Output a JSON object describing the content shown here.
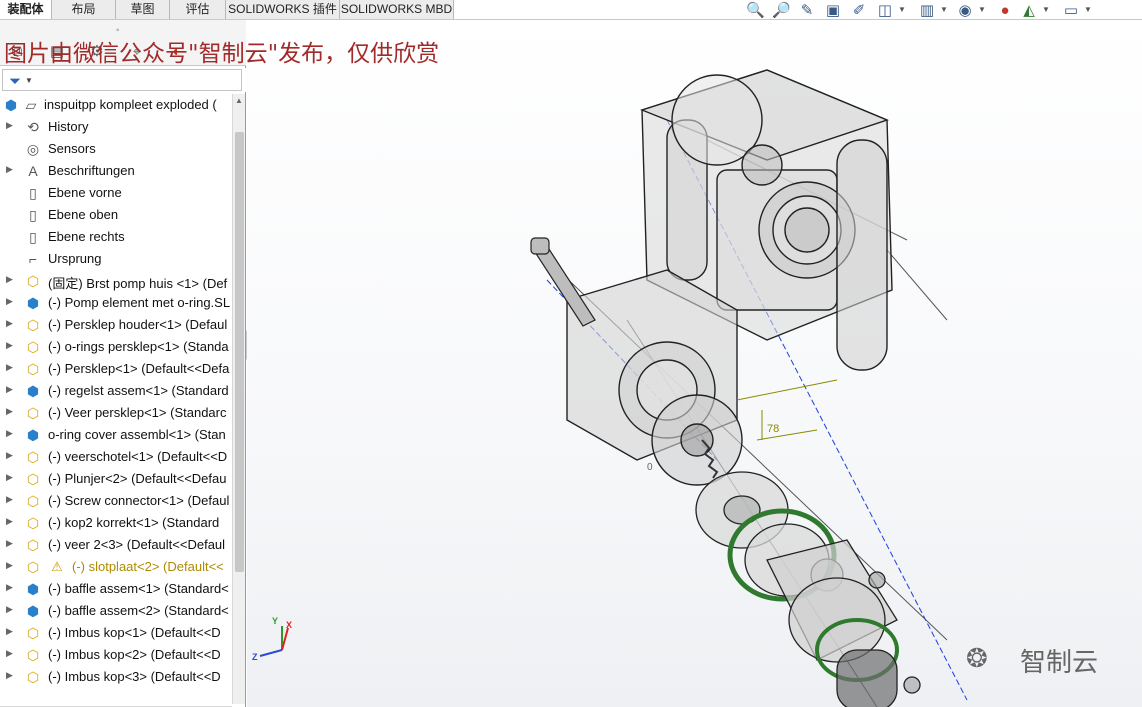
{
  "tabs": [
    {
      "label": "装配体",
      "active": true
    },
    {
      "label": "布局",
      "active": false
    },
    {
      "label": "草图",
      "active": false
    },
    {
      "label": "评估",
      "active": false
    },
    {
      "label": "SOLIDWORKS 插件",
      "active": false
    },
    {
      "label": "SOLIDWORKS MBD",
      "active": false
    }
  ],
  "view_toolbar": {
    "icons": [
      "zoom-to-fit-icon",
      "zoom-to-area-icon",
      "previous-view-icon",
      "section-view-icon",
      "dynamic-annotation-icon",
      "view-orientation-icon",
      "display-style-icon",
      "hide-show-items-icon",
      "edit-appearance-icon",
      "apply-scene-icon",
      "view-settings-icon"
    ]
  },
  "feature_manager": {
    "tabs": [
      "featuremanager-tree-icon",
      "property-manager-icon",
      "configuration-manager-icon",
      "dimxpert-manager-icon",
      "display-manager-icon"
    ],
    "filter_icon": "filter-icon",
    "root": {
      "label": "inspuitpp kompleet exploded  ("
    },
    "items": [
      {
        "label": "History",
        "icon": "history",
        "expandable": true
      },
      {
        "label": "Sensors",
        "icon": "sensor",
        "expandable": false
      },
      {
        "label": "Beschriftungen",
        "icon": "annotation",
        "expandable": true
      },
      {
        "label": "Ebene vorne",
        "icon": "plane",
        "expandable": false
      },
      {
        "label": "Ebene oben",
        "icon": "plane",
        "expandable": false
      },
      {
        "label": "Ebene rechts",
        "icon": "plane",
        "expandable": false
      },
      {
        "label": "Ursprung",
        "icon": "origin",
        "expandable": false
      },
      {
        "label": "(固定) Brst pomp huis <1> (Def",
        "icon": "part",
        "expandable": true
      },
      {
        "label": "(-) Pomp element met o-ring.SL",
        "icon": "assembly",
        "expandable": true
      },
      {
        "label": "(-) Persklep houder<1> (Defaul",
        "icon": "part",
        "expandable": true
      },
      {
        "label": "(-) o-rings persklep<1> (Standa",
        "icon": "part",
        "expandable": true
      },
      {
        "label": "(-) Persklep<1> (Default<<Defa",
        "icon": "part",
        "expandable": true
      },
      {
        "label": "(-) regelst assem<1> (Standard",
        "icon": "assembly",
        "expandable": true
      },
      {
        "label": "(-) Veer persklep<1> (Standarc",
        "icon": "part",
        "expandable": true
      },
      {
        "label": "o-ring cover assembl<1> (Stan",
        "icon": "assembly",
        "expandable": true
      },
      {
        "label": "(-) veerschotel<1> (Default<<D",
        "icon": "part",
        "expandable": true
      },
      {
        "label": "(-) Plunjer<2> (Default<<Defau",
        "icon": "part",
        "expandable": true
      },
      {
        "label": "(-) Screw connector<1> (Defaul",
        "icon": "part",
        "expandable": true
      },
      {
        "label": "(-) kop2 korrekt<1> (Standard",
        "icon": "part",
        "expandable": true
      },
      {
        "label": "(-) veer 2<3> (Default<<Defaul",
        "icon": "part",
        "expandable": true
      },
      {
        "label": "(-) slotplaat<2> (Default<<",
        "icon": "part",
        "expandable": true,
        "warning": true
      },
      {
        "label": "(-) baffle assem<1> (Standard<",
        "icon": "assembly",
        "expandable": true
      },
      {
        "label": "(-) baffle assem<2> (Standard<",
        "icon": "assembly",
        "expandable": true
      },
      {
        "label": "(-) Imbus kop<1> (Default<<D",
        "icon": "part",
        "expandable": true
      },
      {
        "label": "(-) Imbus kop<2> (Default<<D",
        "icon": "part",
        "expandable": true
      },
      {
        "label": "(-) Imbus kop<3> (Default<<D",
        "icon": "part",
        "expandable": true
      }
    ]
  },
  "viewport": {
    "watermark": "图片由微信公众号\"智制云\"发布，仅供欣赏",
    "brand": "智制云",
    "brand_icon": "wechat-icon",
    "triad_labels": [
      "Y",
      "X",
      "Z"
    ],
    "dimension_labels": [
      "0",
      "78"
    ]
  }
}
